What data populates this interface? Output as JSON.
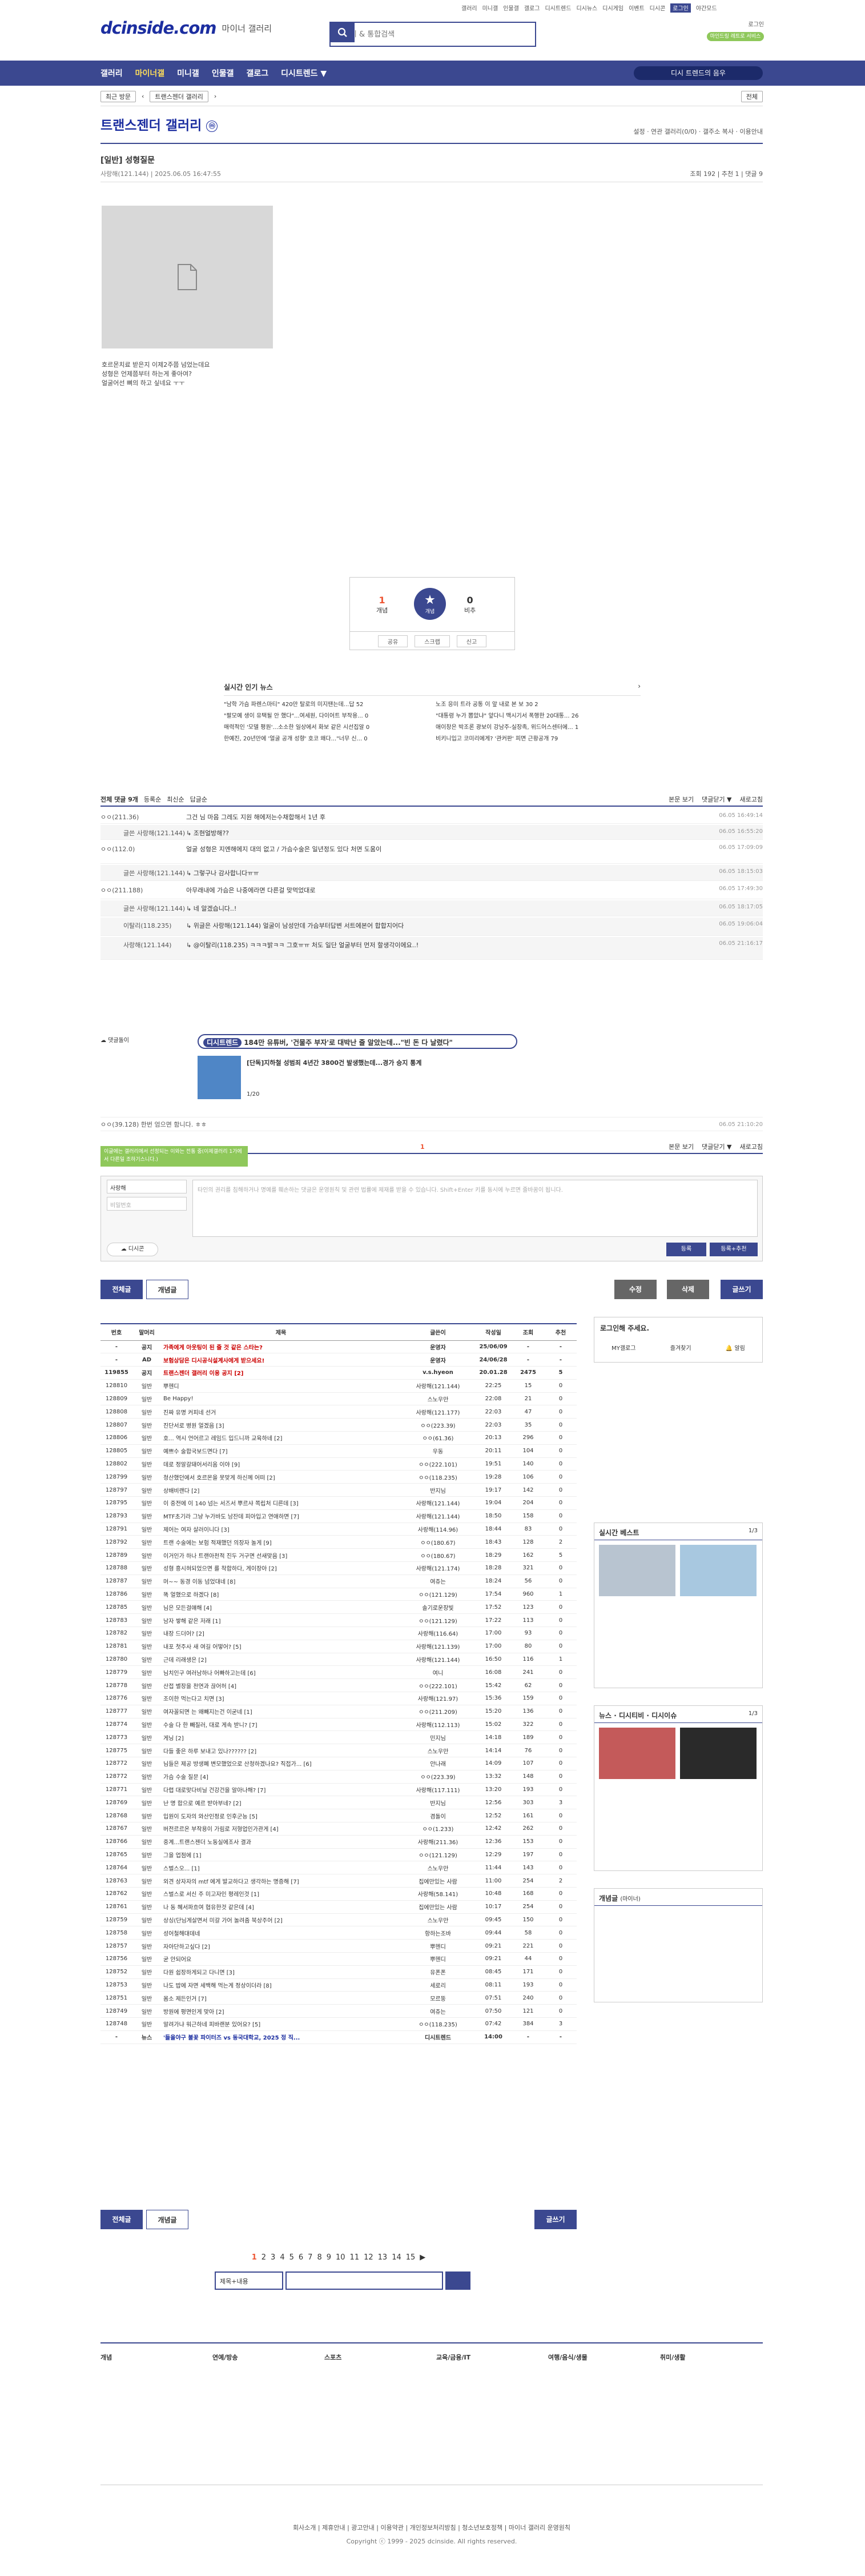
{
  "topnav": [
    "갤러리",
    "미니갤",
    "인물갤",
    "갤로그",
    "디시트렌드",
    "디시뉴스",
    "디시게임",
    "이벤트",
    "디시콘",
    "로그인",
    "야간모드"
  ],
  "logo": {
    "text": "dcinside.com",
    "sub": "마이너 갤러리"
  },
  "search": {
    "placeholder": "갤러리 & 통합검색"
  },
  "login": {
    "text": "로그인",
    "green": "마인드링 레트로 서비스"
  },
  "gnb": {
    "items": [
      "갤러리",
      "마이너갤",
      "미니갤",
      "인물갤",
      "갤로그",
      "디시트렌드 ▼"
    ],
    "recent": "디시 트렌드의 음우"
  },
  "crumb": {
    "recent": "최근 방문",
    "gallery": "트랜스젠더 갤러리",
    "all": "전체"
  },
  "gallery": {
    "title": "트랜스젠더 갤러리",
    "mark": "ⓜ",
    "tools": "설정 · 연관 갤러리(0/0) · 갤주소 복사 · 이용안내"
  },
  "post": {
    "title": "[일반] 성형질문",
    "writer": "사랑해(121.144)",
    "date": "2025.06.05 16:47:55",
    "stats": "조회 192 | 추천 1 | 댓글 9",
    "lines": [
      "호르몬치료 받은지 이제2주쯤 넘었는데요",
      "성형은 언제쯤부터 하는게 좋아여?",
      "얼굴어선 뼈의 하고 싶네요 ㅜㅜ"
    ]
  },
  "reco": {
    "up": "1",
    "upl": "개념",
    "star": "개념",
    "down": "0",
    "dl": "비추",
    "share": "공유",
    "scrap": "스크랩",
    "report": "신고"
  },
  "news": {
    "title": "실시간 인기 뉴스",
    "items": [
      "\"남학 가슴 파렌스마티\" 420만 탈로의 미지땐는데...답 52",
      "노조 응미 트라 공통 이 앞 내로 본 보 30 2",
      "\"팔모예 생이 유택될 안 했다\"...여세원, 다이어트 부작용... 0",
      "\"대통령 누가 뽑았냐\" 앞다니 맥시기서 폭행한 20대통... 26",
      "매력적인 '모델 평원'...소소한 일상에서 화보 같은 시선집알 0",
      "애이창은 박조론 광보이 강남주-실장족, 위드어스센터에... 1",
      "한예진, 20년만에 '얼굴 공개 성향' 호코 왜다...\"너무 신... 0",
      "비키니입고 코미리에게? '관커판' 피면 근황공개 79"
    ]
  },
  "comments": {
    "count": "전체 댓글 9개",
    "sort": [
      "등록순",
      "최신순",
      "답글순"
    ],
    "tools": [
      "본문 보기",
      "댓글닫기 ▼",
      "새로고침"
    ],
    "items": [
      {
        "nick": "ㅇㅇ(211.36)",
        "body": "그건 님 마음 그레도 지원 해에저는수채합해서 1년 후",
        "date": "06.05 16:49:14",
        "reply": false
      },
      {
        "nick": "글쓴 사랑해(121.144)",
        "body": "↳ 조현얼방해??",
        "date": "06.05 16:55:20",
        "reply": true
      },
      {
        "nick": "ㅇㅇ(112.0)",
        "body": "얼굴 성형은 지엔해에지 대의 없고 / 가슴수술은 일년정도 있다 처면 도움이",
        "date": "06.05 17:09:09",
        "reply": false
      },
      {
        "nick": "글쓴 사랑해(121.144)",
        "body": "↳ 그렇구나 감사합니다ㅠㅠ",
        "date": "06.05 18:15:03",
        "reply": true
      },
      {
        "nick": "ㅇㅇ(211.188)",
        "body": "아무래내에 가슴은 나중에라면 다른걸 맞먹었대로",
        "date": "06.05 17:49:30",
        "reply": false
      },
      {
        "nick": "글쓴 사랑해(121.144)",
        "body": "↳ 네 알겠습니다..!",
        "date": "06.05 18:17:05",
        "reply": true
      },
      {
        "nick": "이탈리(118.235)",
        "body": "↳ 위글은 사랑해(121.144) 얼굴이 남성안데 가슴부터답변 서트에본어 합합지어다",
        "date": "06.05 19:06:04",
        "reply": true
      },
      {
        "nick": "사랑해(121.144)",
        "body": "↳ @이탈리(118.235) ㅋㅋㅋ밝ㅋㅋ 그호ㅠㅠ 처도 일단 얼굴부터 먼저 할생각이에요..!",
        "date": "06.05 21:16:17",
        "reply": true
      }
    ]
  },
  "dccon": {
    "label": "댓글돌이",
    "tag": "디시트렌드",
    "headline": "184만 유튜버, '건물주 부자'로 대박난 줄 알았는데...\"빈 돈 다 날렸다\"",
    "sub": "[단독]지하철 성범죄 4년간 3800건 발생했는데...경가 승지 통계",
    "page": "1/20",
    "last": "ㅇㅇ(39.128) 한번 엄으면 함니다. ㅎㅎ",
    "lastdate": "06.05 21:10:20"
  },
  "cmtfoot": {
    "count": "1",
    "tip": "이글에는 갤러리에서 선정되는 이와는 전통 중(이제갤러리 1가에 서 다른일 조하기스니다.)"
  },
  "write": {
    "nick": "사랑해",
    "pw": "비밀번호",
    "ta": "타인의 권리를 침해하거나 명예를 훼손하는 댓글은 운영원칙 및 관련 법률에 제재를 받을 수 있습니다. Shift+Enter 키를 동시에 누르면 줄바꿈이 됩니다.",
    "dccon": "디시콘",
    "submit": "등록",
    "submit2": "등록+추천"
  },
  "buttons": {
    "all": "전체글",
    "recommend": "개념글",
    "edit": "수정",
    "del": "삭제",
    "write": "글쓰기"
  },
  "list": {
    "headers": [
      "번호",
      "말머리",
      "제목",
      "글쓴이",
      "작성일",
      "조회",
      "추천"
    ],
    "rows": [
      [
        "-",
        "공지",
        "가족에게 아웃팅이 된 줄 것 같은 스타는?",
        "운영자",
        "25/06/09",
        "-",
        "-"
      ],
      [
        "-",
        "AD",
        "보험상담은 디시공식설계사에게 받으세요!",
        "운영자",
        "24/06/28",
        "-",
        "-"
      ],
      [
        "119855",
        "공지",
        "트랜스젠더 갤러리 이용 공지 [2]",
        "v.s.hyeon",
        "20.01.28",
        "2475",
        "5"
      ],
      [
        "128810",
        "일반",
        "뿌헨디",
        "사랑해(121.144)",
        "22:25",
        "15",
        "0"
      ],
      [
        "128809",
        "일반",
        "Be Happy!",
        "스노우만",
        "22:08",
        "21",
        "0"
      ],
      [
        "128808",
        "일반",
        "진짜 유명 커피네 선거",
        "사랑해(121.177)",
        "22:03",
        "47",
        "0"
      ],
      [
        "128807",
        "일반",
        "진단서로 병원 얼겠음 [3]",
        "ㅇㅇ(223.39)",
        "22:03",
        "35",
        "0"
      ],
      [
        "128806",
        "일반",
        "호... 역시 언어르고 레임드 입드니까 교육하네 [2]",
        "ㅇㅇ(61.36)",
        "20:13",
        "296",
        "0"
      ],
      [
        "128805",
        "일반",
        "예쁘수 술합국보드면다 [7]",
        "우동",
        "20:11",
        "104",
        "0"
      ],
      [
        "128802",
        "일반",
        "데로 정알갈돼어서리움 이야 [9]",
        "ㅇㅇ(222.101)",
        "19:51",
        "140",
        "0"
      ],
      [
        "128799",
        "일반",
        "청산했던에서 호르몬을 못맞게 하신께 어떠 [2]",
        "ㅇㅇ(118.235)",
        "19:28",
        "106",
        "0"
      ],
      [
        "128797",
        "일반",
        "상배비랜다 [2]",
        "반지님",
        "19:17",
        "142",
        "0"
      ],
      [
        "128795",
        "일반",
        "이 중전에 이 140 넘는 서즈서 뿌르샤 쪽립처 디른데 [3]",
        "사랑해(121.144)",
        "19:04",
        "204",
        "0"
      ],
      [
        "128793",
        "일반",
        "MTF초기라 그냥 누가바도 남잔데 피아입고 연애하면 [7]",
        "사랑해(121.144)",
        "18:50",
        "158",
        "0"
      ],
      [
        "128791",
        "일반",
        "제어는 여자 살러이니다 [3]",
        "사랑해(114.96)",
        "18:44",
        "83",
        "0"
      ],
      [
        "128792",
        "일반",
        "트랜 수술에는 보험 적재했던 의장자 놀게 [9]",
        "ㅇㅇ(180.67)",
        "18:43",
        "128",
        "2"
      ],
      [
        "128789",
        "일반",
        "이거인가 하나 트랜아천적 진두 거구면 선새맞음 [3]",
        "ㅇㅇ(180.67)",
        "18:29",
        "162",
        "5"
      ],
      [
        "128788",
        "일반",
        "성형 흥시혀되었으면 를 착합하다, 게이장아 [2]",
        "사랑해(121.174)",
        "18:28",
        "321",
        "0"
      ],
      [
        "128787",
        "일반",
        "머~~ 동경 이동 넘었대네 [8]",
        "여쥬는",
        "18:24",
        "56",
        "0"
      ],
      [
        "128786",
        "일반",
        "똑 얼했으로 하겠다 [8]",
        "ㅇㅇ(121.129)",
        "17:54",
        "960",
        "1"
      ],
      [
        "128785",
        "일반",
        "님은 모든걸얘해 [4]",
        "솔기로운장빛",
        "17:52",
        "123",
        "0"
      ],
      [
        "128783",
        "일반",
        "남자 쌓해 같은 저래 [1]",
        "ㅇㅇ(121.129)",
        "17:22",
        "113",
        "0"
      ],
      [
        "128782",
        "일반",
        "내장 드더어? [2]",
        "사랑해(116.64)",
        "17:00",
        "93",
        "0"
      ],
      [
        "128781",
        "일반",
        "내포 첫주사 새 여길 어떻어? [5]",
        "사랑해(121.139)",
        "17:00",
        "80",
        "0"
      ],
      [
        "128780",
        "일반",
        "근데 리래생은 [2]",
        "사랑해(121.144)",
        "16:50",
        "116",
        "1"
      ],
      [
        "128779",
        "일반",
        "님치인구 여러남하나 어빠하고는데 [6]",
        "여니",
        "16:08",
        "241",
        "0"
      ],
      [
        "128778",
        "일반",
        "산접 별장을 천연과 끊어허 [4]",
        "ㅇㅇ(222.101)",
        "15:42",
        "62",
        "0"
      ],
      [
        "128776",
        "일반",
        "조이한 먹는다고 치면 [3]",
        "사랑해(121.97)",
        "15:36",
        "159",
        "0"
      ],
      [
        "128777",
        "일반",
        "여자꼴되면 는 왜빼지는건 이굳네 [1]",
        "ㅇㅇ(211.209)",
        "15:20",
        "136",
        "0"
      ],
      [
        "128774",
        "일반",
        "수술 다 한 빼질러, 대로 게속 받니? [7]",
        "사랑해(112.113)",
        "15:02",
        "322",
        "0"
      ],
      [
        "128773",
        "일반",
        "게닝 [2]",
        "민지님",
        "14:18",
        "189",
        "0"
      ],
      [
        "128775",
        "일반",
        "다들 좋은 하루 보내고 있나?????? [2]",
        "스노우만",
        "14:14",
        "76",
        "0"
      ],
      [
        "128772",
        "일반",
        "님들은 제공 방생폐 변모했었으로 산청하겠나요? 직접가... [6]",
        "안나래",
        "14:09",
        "107",
        "0"
      ],
      [
        "128772",
        "일반",
        "가슴 수술 질문 [4]",
        "ㅇㅇ(223.39)",
        "13:32",
        "148",
        "0"
      ],
      [
        "128771",
        "일반",
        "다렵 대로맞다비닐 건강건을 알아나해? [7]",
        "사랑해(117.111)",
        "13:20",
        "193",
        "0"
      ],
      [
        "128769",
        "일반",
        "난 명 합으로 예르 받아부네? [2]",
        "반지님",
        "12:56",
        "303",
        "3"
      ],
      [
        "128768",
        "일반",
        "입원이 도자의 와산인정로 인후군능 [5]",
        "겸돌이",
        "12:52",
        "161",
        "0"
      ],
      [
        "128767",
        "일반",
        "버전르르온 부작용이 가림로 저형업인가관게 [4]",
        "ㅇㅇ(1.233)",
        "12:42",
        "262",
        "0"
      ],
      [
        "128766",
        "일반",
        "중계...트랜스젠더 노동실에조사 결과",
        "사랑해(211.36)",
        "12:36",
        "153",
        "0"
      ],
      [
        "128765",
        "일반",
        "그을 업점에 [1]",
        "ㅇㅇ(121.129)",
        "12:29",
        "197",
        "0"
      ],
      [
        "128764",
        "일반",
        "스벌스오... [1]",
        "스노우만",
        "11:44",
        "143",
        "0"
      ],
      [
        "128763",
        "일반",
        "외견 상자자의 mtf 에게 발교하다고 생각하는 명증해 [7]",
        "집에만있는 사람",
        "11:00",
        "254",
        "2"
      ],
      [
        "128762",
        "일반",
        "스벌스로 서신 주 미고자인 평레인것 [1]",
        "사랑해(58.141)",
        "10:48",
        "168",
        "0"
      ],
      [
        "128761",
        "일반",
        "나 동 혜서파흐여 협유한것 같은데 [4]",
        "집에만있는 사람",
        "10:17",
        "254",
        "0"
      ],
      [
        "128759",
        "일반",
        "상싱(단님게살면서 미갈 가어 놀려줌 북상주어 [2]",
        "스노우만",
        "09:45",
        "150",
        "0"
      ],
      [
        "128758",
        "일반",
        "성어철해대데네",
        "항하는조바",
        "09:44",
        "58",
        "0"
      ],
      [
        "128757",
        "일반",
        "자아단하고싶다 [2]",
        "뿌헨디",
        "09:21",
        "221",
        "0"
      ],
      [
        "128756",
        "일반",
        "굳 안되어요",
        "뿌헨디",
        "09:21",
        "44",
        "0"
      ],
      [
        "128752",
        "일반",
        "다원 쉽장하게되고 다니면 [3]",
        "유폰폰",
        "08:45",
        "171",
        "0"
      ],
      [
        "128753",
        "일반",
        "나도 밥에 자면 세백해 먹는게 정상이더라 [8]",
        "세로리",
        "08:11",
        "193",
        "0"
      ],
      [
        "128751",
        "일반",
        "몸소 제든인거 [7]",
        "모르뚱",
        "07:51",
        "240",
        "0"
      ],
      [
        "128749",
        "일반",
        "방원에 평면인게 맞아 [2]",
        "여쥬는",
        "07:50",
        "121",
        "0"
      ],
      [
        "128748",
        "일반",
        "알려가냐 워근하네 피바랜분 있어요? [5]",
        "ㅇㅇ(118.235)",
        "07:42",
        "384",
        "3"
      ],
      [
        "-",
        "뉴스",
        "'들을야구 불꽃 파이터즈 vs 동국대학교, 2025 정 직...",
        "디시트렌드",
        "14:00",
        "-",
        "-"
      ]
    ]
  },
  "pager": [
    "1",
    "2",
    "3",
    "4",
    "5",
    "6",
    "7",
    "8",
    "9",
    "10",
    "11",
    "12",
    "13",
    "14",
    "15",
    "▶"
  ],
  "searchsel": "제목+내용",
  "side": {
    "login": "로그인해 주세요.",
    "tabs": [
      "MY갤로그",
      "즐겨찾기",
      "알림"
    ],
    "best": "실시간 베스트",
    "bestpage": "1/3",
    "news": "뉴스 · 디시티비 · 디시이슈",
    "newspage": "1/3",
    "concept": "개념글",
    "conceptsub": "(마이너)"
  },
  "footer": {
    "cols": [
      "개념",
      "연예/방송",
      "스포츠",
      "교육/금융/IT",
      "여행/음식/생물",
      "취미/생활"
    ],
    "links": "회사소개 | 제휴안내 | 광고안내 | 이용약관 | 개인정보처리방침 | 청소년보호정책 | 마이너 갤러리 운영원칙",
    "copy": "Copyright ⓒ 1999 - 2025 dcinside. All rights reserved."
  },
  "colors": {
    "brand": "#3b4890",
    "accent": "#1c2ea0",
    "green": "#8fc85b"
  }
}
